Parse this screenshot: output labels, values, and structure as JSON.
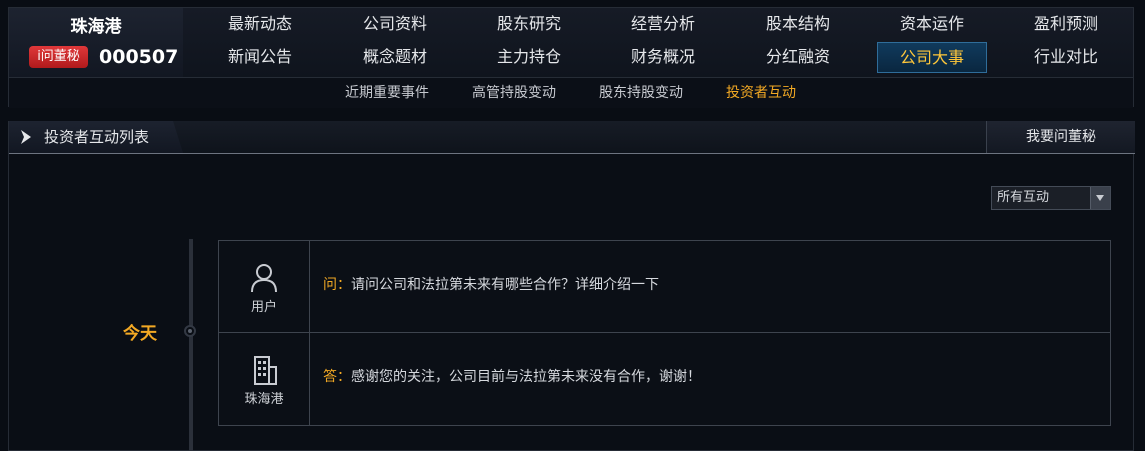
{
  "stock": {
    "name": "珠海港",
    "code": "000507",
    "ask_label": "i问董秘"
  },
  "nav": {
    "row1": [
      "最新动态",
      "公司资料",
      "股东研究",
      "经营分析",
      "股本结构",
      "资本运作",
      "盈利预测"
    ],
    "row2": [
      "新闻公告",
      "概念题材",
      "主力持仓",
      "财务概况",
      "分红融资",
      "公司大事",
      "行业对比"
    ],
    "active": "公司大事"
  },
  "subnav": {
    "items": [
      "近期重要事件",
      "高管持股变动",
      "股东持股变动",
      "投资者互动"
    ],
    "active": "投资者互动"
  },
  "panel": {
    "title": "投资者互动列表",
    "ask_button": "我要问董秘",
    "filter_value": "所有互动"
  },
  "timeline": {
    "date_label": "今天"
  },
  "qa": {
    "question": {
      "who": "用户",
      "prefix": "问：",
      "text": "请问公司和法拉第未来有哪些合作？详细介绍一下"
    },
    "answer": {
      "who": "珠海港",
      "prefix": "答：",
      "text": "感谢您的关注，公司目前与法拉第未来没有合作，谢谢！"
    }
  },
  "colors": {
    "background": "#090d14",
    "accent_orange": "#f3a924",
    "active_tab_text": "#ffc73a",
    "badge_red": "#d0282a"
  }
}
